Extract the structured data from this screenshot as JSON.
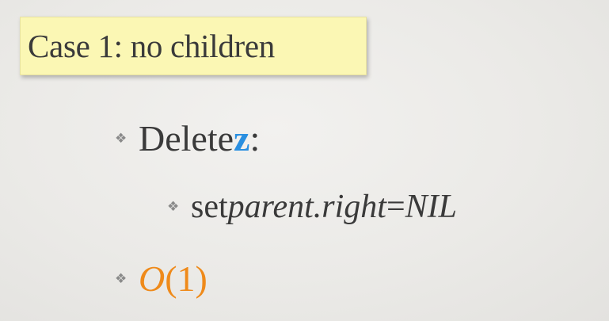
{
  "title": "Case 1:  no children",
  "bullets": {
    "delete_label": "Delete ",
    "delete_var": "z",
    "delete_colon": ":",
    "sub_set": "set ",
    "sub_expr": "parent.right",
    "sub_eq": " = ",
    "sub_nil": "NIL",
    "complexity_o": "O",
    "complexity_arg": "(1)"
  },
  "icons": {
    "bullet": "diamond-cluster-bullet-icon"
  },
  "colors": {
    "title_bg": "#fbf7b4",
    "variable": "#2a8fe0",
    "complexity": "#ef8a1a",
    "text": "#3a3a3a"
  }
}
